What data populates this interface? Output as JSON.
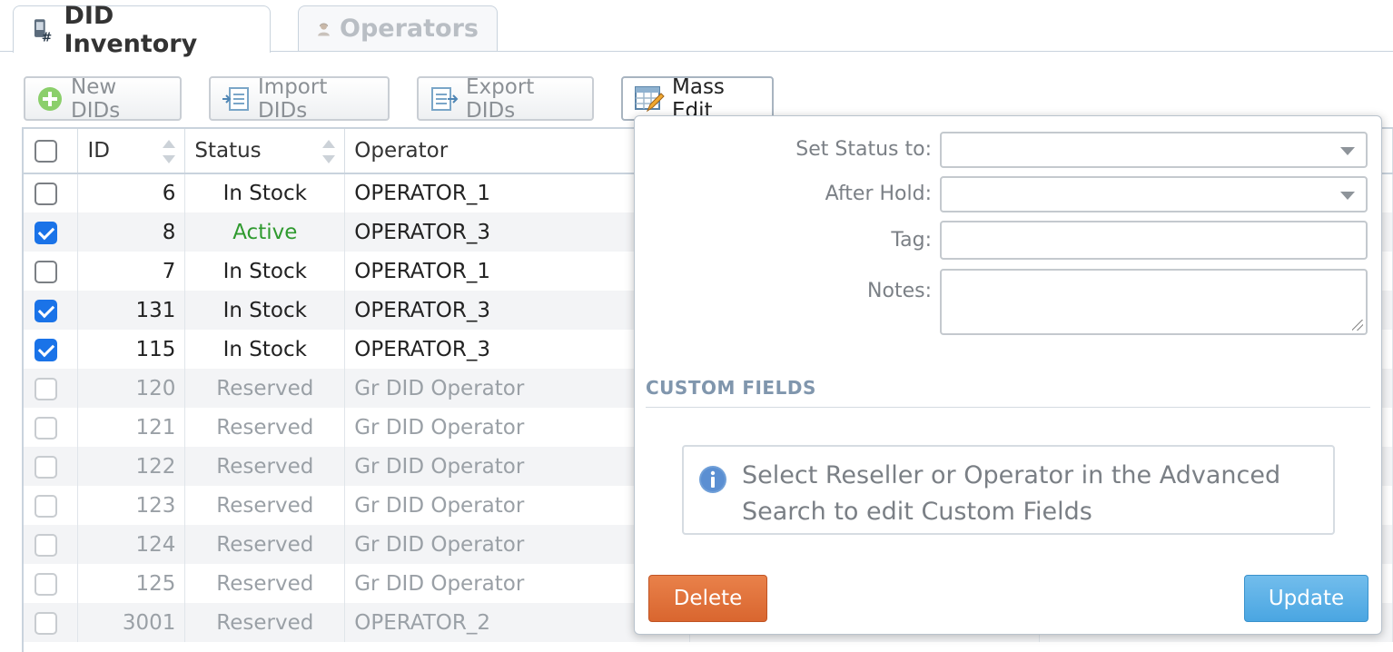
{
  "tabs": [
    {
      "label": "DID Inventory",
      "icon": "did-inventory-icon",
      "active": true
    },
    {
      "label": "Operators",
      "icon": "operators-icon",
      "active": false
    }
  ],
  "toolbar": {
    "new_dids": "New DIDs",
    "import_dids": "Import DIDs",
    "export_dids": "Export DIDs",
    "mass_edit": "Mass Edit"
  },
  "table": {
    "columns": {
      "id": "ID",
      "status": "Status",
      "operator": "Operator"
    },
    "rows": [
      {
        "id": "6",
        "status": "In Stock",
        "operator": "OPERATOR_1",
        "checked": false,
        "dim": false
      },
      {
        "id": "8",
        "status": "Active",
        "operator": "OPERATOR_3",
        "checked": true,
        "dim": false
      },
      {
        "id": "7",
        "status": "In Stock",
        "operator": "OPERATOR_1",
        "checked": false,
        "dim": false
      },
      {
        "id": "131",
        "status": "In Stock",
        "operator": "OPERATOR_3",
        "checked": true,
        "dim": false
      },
      {
        "id": "115",
        "status": "In Stock",
        "operator": "OPERATOR_3",
        "checked": true,
        "dim": false
      },
      {
        "id": "120",
        "status": "Reserved",
        "operator": "Gr DID Operator",
        "checked": false,
        "dim": true
      },
      {
        "id": "121",
        "status": "Reserved",
        "operator": "Gr DID Operator",
        "checked": false,
        "dim": true
      },
      {
        "id": "122",
        "status": "Reserved",
        "operator": "Gr DID Operator",
        "checked": false,
        "dim": true
      },
      {
        "id": "123",
        "status": "Reserved",
        "operator": "Gr DID Operator",
        "checked": false,
        "dim": true
      },
      {
        "id": "124",
        "status": "Reserved",
        "operator": "Gr DID Operator",
        "checked": false,
        "dim": true
      },
      {
        "id": "125",
        "status": "Reserved",
        "operator": "Gr DID Operator",
        "checked": false,
        "dim": true
      },
      {
        "id": "3001",
        "status": "Reserved",
        "operator": "OPERATOR_2",
        "checked": false,
        "dim": true
      }
    ]
  },
  "mass_edit": {
    "set_status_label": "Set Status to:",
    "set_status_value": "",
    "after_hold_label": "After Hold:",
    "after_hold_value": "",
    "tag_label": "Tag:",
    "tag_value": "",
    "notes_label": "Notes:",
    "notes_value": "",
    "custom_fields_title": "CUSTOM FIELDS",
    "info_text": "Select Reseller or Operator in the Advanced Search to edit Custom Fields",
    "delete_label": "Delete",
    "update_label": "Update"
  },
  "colors": {
    "active_status": "#2f9a2f",
    "delete_button": "#e0733c",
    "update_button": "#5cb1e7",
    "section_title": "#8096ad"
  }
}
